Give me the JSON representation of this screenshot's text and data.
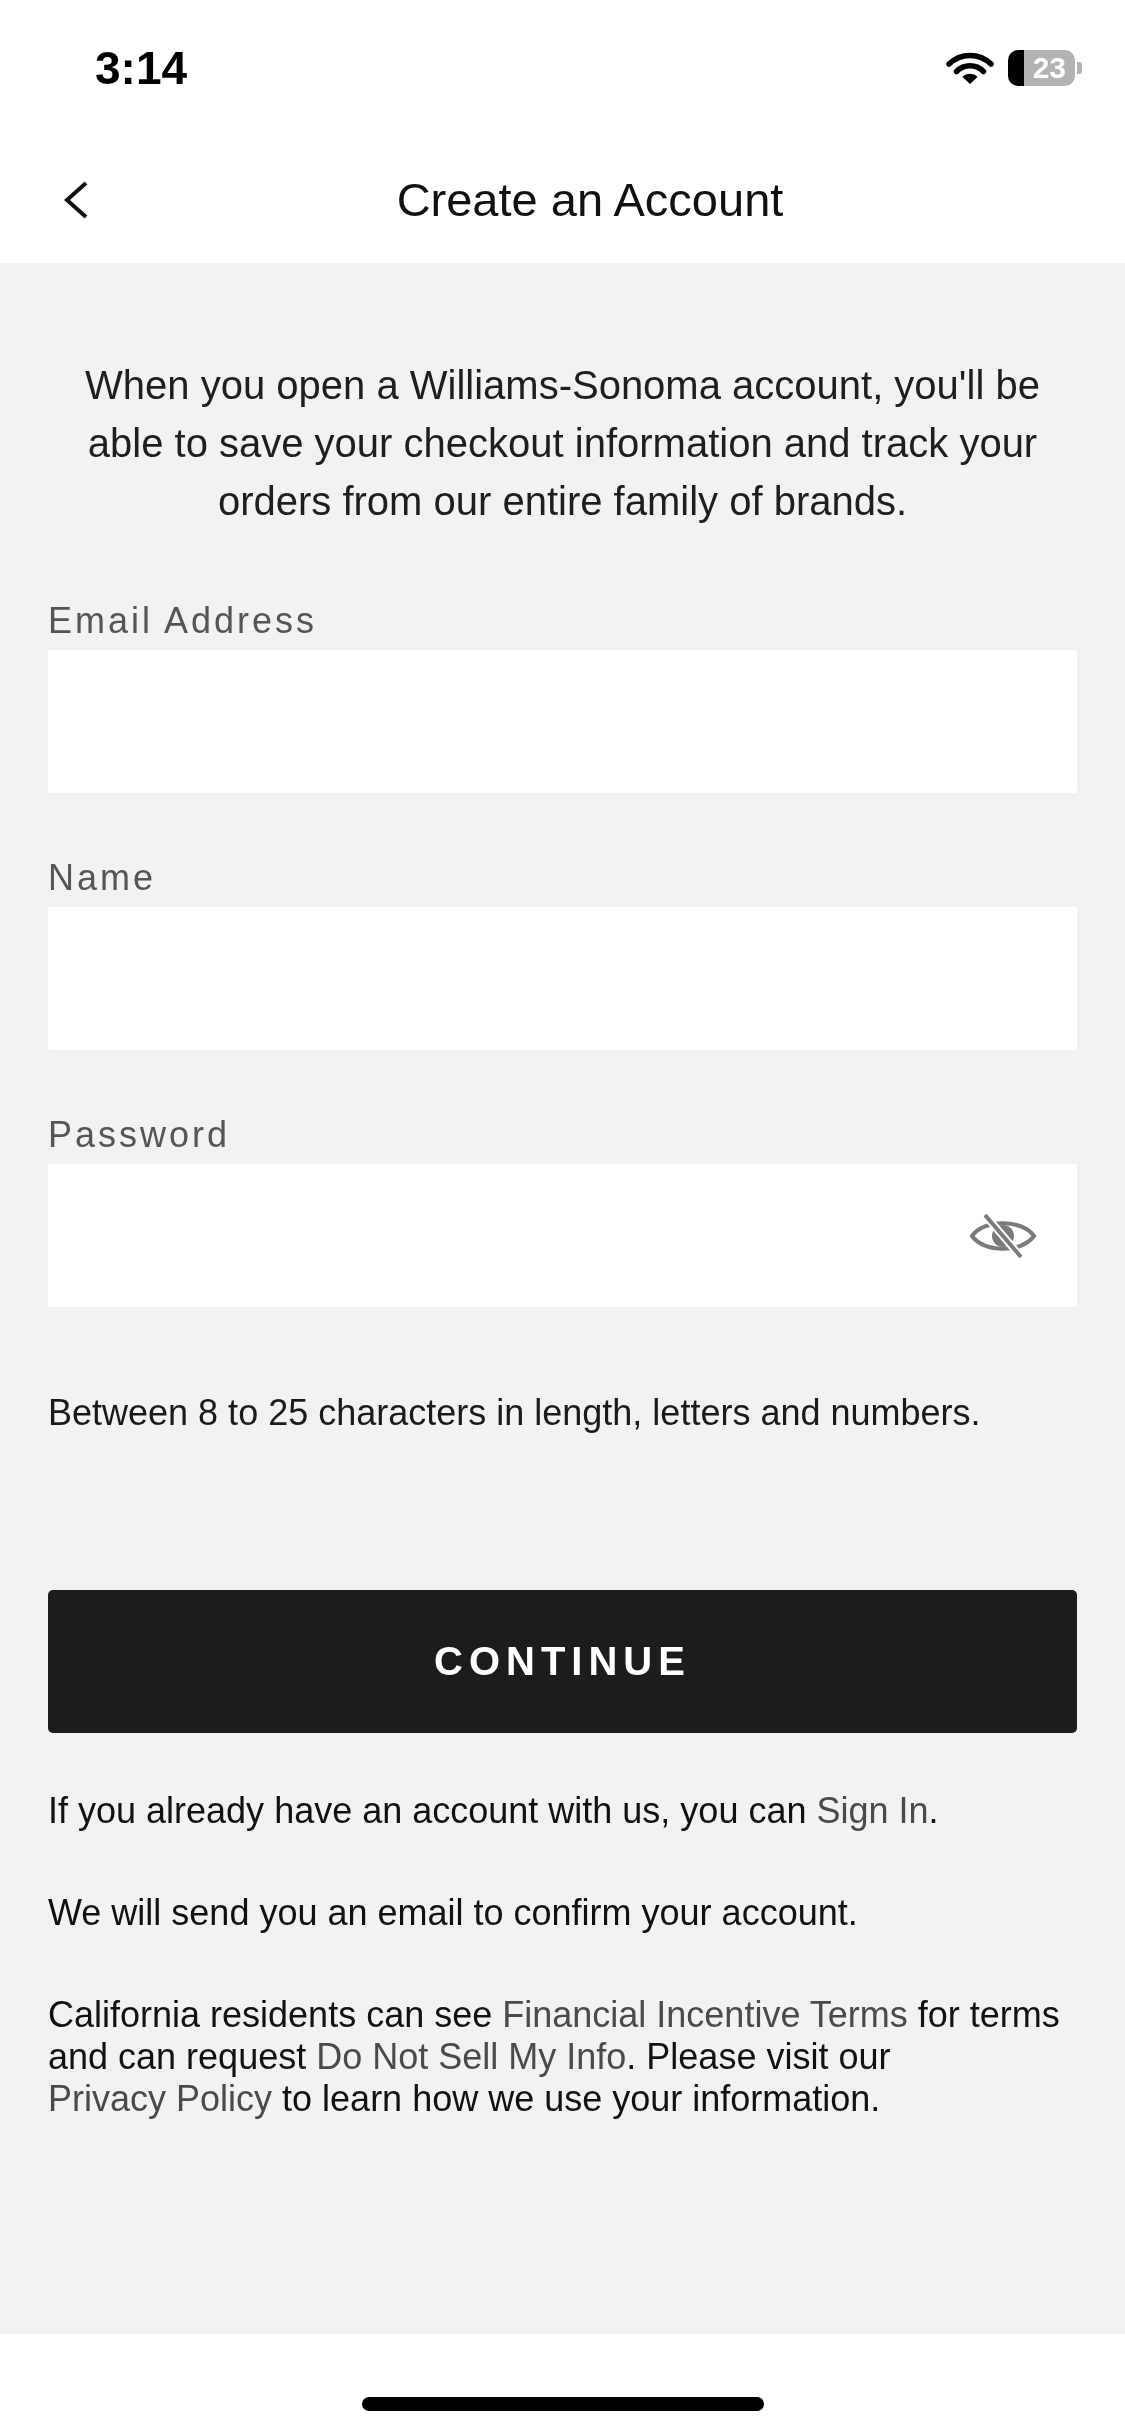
{
  "status_bar": {
    "time": "3:14",
    "battery": "23"
  },
  "header": {
    "title": "Create an Account"
  },
  "intro": "When you open a Williams-Sonoma account, you'll be able to save your checkout information and track your orders from our entire family of brands.",
  "fields": [
    {
      "kind": "email",
      "label": "Email Address"
    },
    {
      "kind": "name",
      "label": "Name"
    },
    {
      "kind": "password",
      "label": "Password",
      "password_visible": false
    }
  ],
  "password_hint": "Between 8 to 25 characters in length, letters and numbers.",
  "continue_button": "CONTINUE",
  "notes": [
    {
      "segments": [
        {
          "kind": "text",
          "text": "If you already have an account with us, you can "
        },
        {
          "kind": "link",
          "text": "Sign In"
        },
        {
          "kind": "text",
          "text": "."
        }
      ]
    },
    {
      "segments": [
        {
          "kind": "text",
          "text": "We will send you an email to confirm your account."
        }
      ]
    },
    {
      "segments": [
        {
          "kind": "text",
          "text": "California residents can see "
        },
        {
          "kind": "link",
          "text": "Financial Incentive Terms"
        },
        {
          "kind": "text",
          "text": " for terms and can request "
        },
        {
          "kind": "link",
          "text": "Do Not Sell My Info"
        },
        {
          "kind": "text",
          "text": ". Please visit our "
        },
        {
          "kind": "link",
          "text": "Privacy Policy"
        },
        {
          "kind": "text",
          "text": " to learn how we use your information."
        }
      ]
    }
  ]
}
